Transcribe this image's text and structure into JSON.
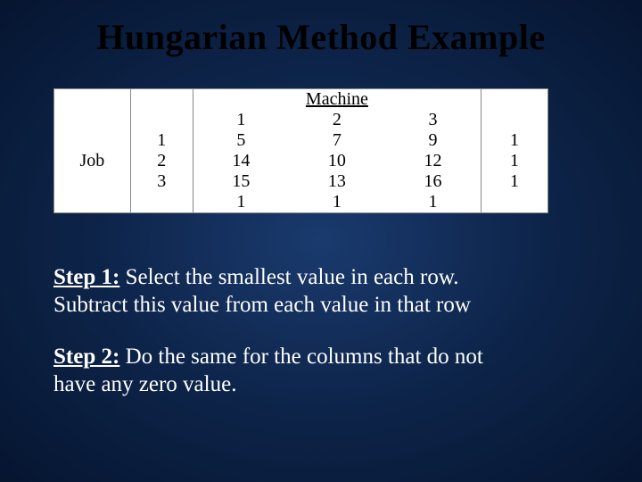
{
  "title": "Hungarian Method Example",
  "table": {
    "machine_header": "Machine",
    "machine_cols": [
      "1",
      "2",
      "3"
    ],
    "job_label": "Job",
    "job_nums": [
      "1",
      "2",
      "3"
    ],
    "rows": [
      [
        "5",
        "7",
        "9",
        "1"
      ],
      [
        "14",
        "10",
        "12",
        "1"
      ],
      [
        "15",
        "13",
        "16",
        "1"
      ]
    ],
    "bottom_row": [
      "1",
      "1",
      "1"
    ]
  },
  "steps": {
    "step1_label": "Step 1:",
    "step1_text_a": "  Select the smallest value in each row.",
    "step1_text_b": "Subtract this value from each value in that row",
    "step2_label": "Step 2:",
    "step2_text_a": " Do the same for the columns that do not",
    "step2_text_b": "have any zero value."
  }
}
